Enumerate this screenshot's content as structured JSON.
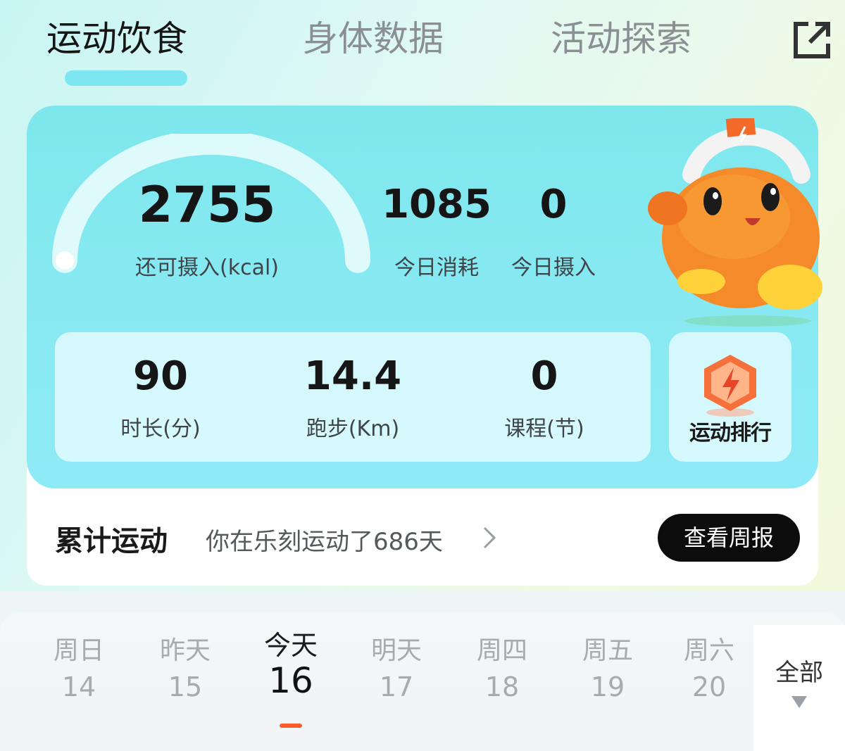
{
  "tabs": [
    {
      "label": "运动饮食",
      "active": true
    },
    {
      "label": "身体数据",
      "active": false
    },
    {
      "label": "活动探索",
      "active": false
    }
  ],
  "calories": {
    "remaining_value": "2755",
    "remaining_label": "还可摄入(kcal)",
    "consumed_value": "1085",
    "consumed_label": "今日消耗",
    "intake_value": "0",
    "intake_label": "今日摄入"
  },
  "stats": [
    {
      "value": "90",
      "label": "时长(分)"
    },
    {
      "value": "14.4",
      "label": "跑步(Km)"
    },
    {
      "value": "0",
      "label": "课程(节)"
    }
  ],
  "rank": {
    "label": "运动排行"
  },
  "cumulative": {
    "title": "累计运动",
    "text": "你在乐刻运动了686天",
    "button": "查看周报"
  },
  "days": [
    {
      "weekday": "周日",
      "date": "14",
      "active": false
    },
    {
      "weekday": "昨天",
      "date": "15",
      "active": false
    },
    {
      "weekday": "今天",
      "date": "16",
      "active": true
    },
    {
      "weekday": "明天",
      "date": "17",
      "active": false
    },
    {
      "weekday": "周四",
      "date": "18",
      "active": false
    },
    {
      "weekday": "周五",
      "date": "19",
      "active": false
    },
    {
      "weekday": "周六",
      "date": "20",
      "active": false
    }
  ],
  "all_filter": {
    "label": "全部"
  },
  "icons": {
    "share": "share-external-icon",
    "chevron": "chevron-right-icon",
    "caret": "caret-down-icon",
    "rank_badge": "lightning-badge-icon",
    "mascot": "kettlebell-mascot"
  },
  "colors": {
    "card_teal": "#86e9f1",
    "tab_indicator": "#6fe3ee",
    "accent_orange": "#ff5a2a",
    "button_dark": "#0c0c0c"
  }
}
